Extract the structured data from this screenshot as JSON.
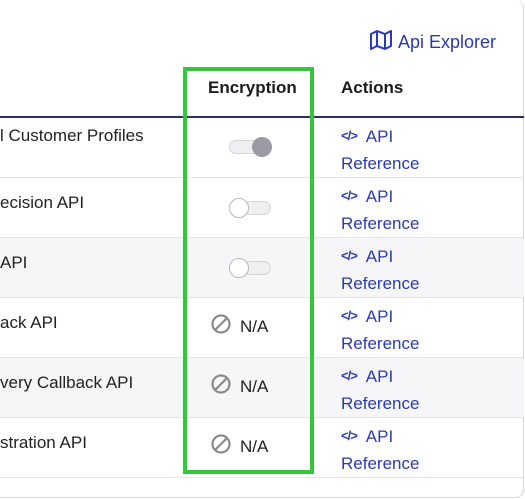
{
  "header": {
    "explorer_label": "Api Explorer"
  },
  "columns": {
    "encryption": "Encryption",
    "actions": "Actions"
  },
  "rows": [
    {
      "name": "l Customer Profiles",
      "encryption": "toggle-on",
      "action_line1": "API",
      "action_line2": "Reference"
    },
    {
      "name": "ecision API",
      "encryption": "toggle-off",
      "action_line1": "API",
      "action_line2": "Reference"
    },
    {
      "name": "API",
      "encryption": "toggle-off",
      "action_line1": "API",
      "action_line2": "Reference"
    },
    {
      "name": "ack API",
      "encryption": "N/A",
      "action_line1": "API",
      "action_line2": "Reference"
    },
    {
      "name": "very Callback API",
      "encryption": "N/A",
      "action_line1": "API",
      "action_line2": "Reference"
    },
    {
      "name": "stration API",
      "encryption": "N/A",
      "action_line1": "API",
      "action_line2": "Reference"
    }
  ],
  "icons": {
    "explorer": "map-icon",
    "action": "code-icon",
    "na": "prohibited-icon"
  },
  "colors": {
    "link": "#2a3ab7",
    "highlight": "#35c63b",
    "header_rule": "#2d2f6b"
  }
}
